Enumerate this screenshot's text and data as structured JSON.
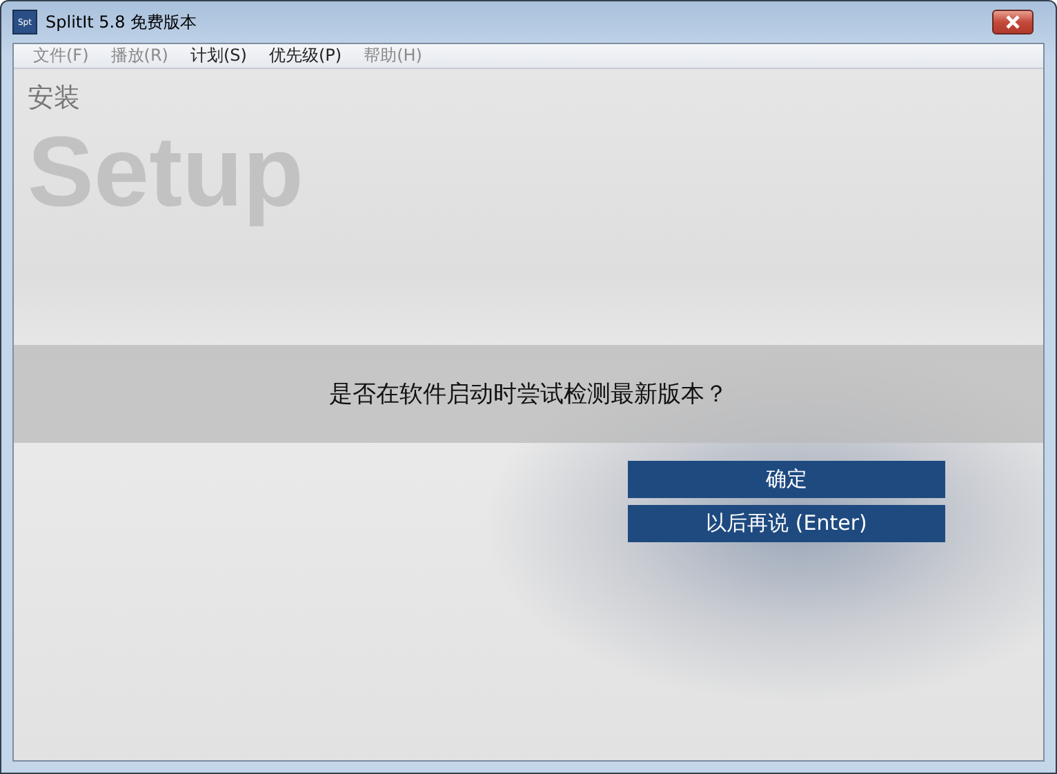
{
  "window": {
    "title": "SplitIt 5.8 免费版本",
    "app_icon": "Spt"
  },
  "menu": [
    {
      "label": "文件(F)",
      "disabled": true
    },
    {
      "label": "播放(R)",
      "disabled": true
    },
    {
      "label": "计划(S)",
      "disabled": false
    },
    {
      "label": "优先级(P)",
      "disabled": false
    },
    {
      "label": "帮助(H)",
      "disabled": true
    }
  ],
  "header": {
    "title": "安装",
    "backdrop": "Setup"
  },
  "question": "是否在软件启动时尝试检测最新版本？",
  "buttons": [
    {
      "label": "确定"
    },
    {
      "label": "以后再说 (Enter)"
    }
  ]
}
